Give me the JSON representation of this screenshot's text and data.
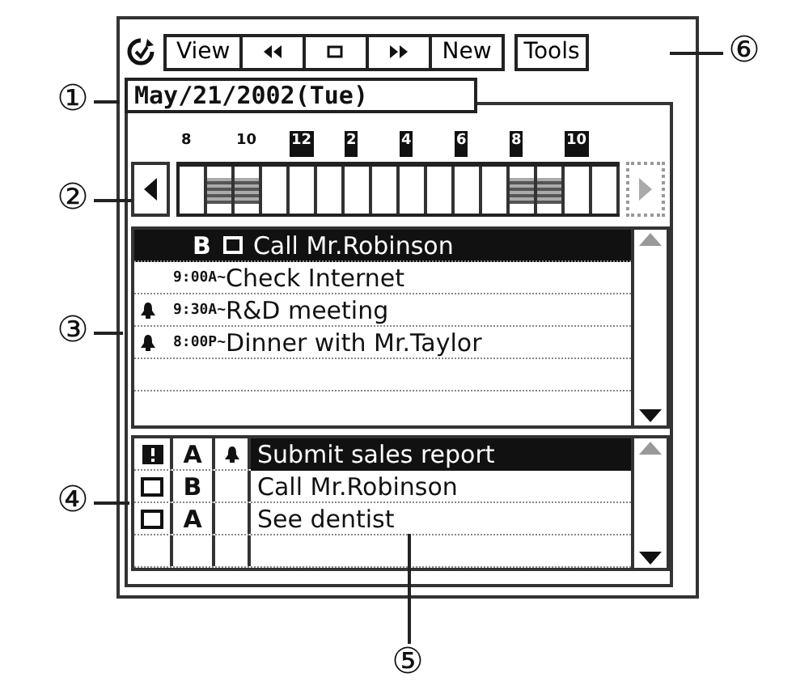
{
  "toolbar": {
    "buttons": [
      {
        "kind": "text",
        "label": "View"
      },
      {
        "kind": "rewind"
      },
      {
        "kind": "stop"
      },
      {
        "kind": "forward"
      },
      {
        "kind": "text",
        "label": "New"
      }
    ],
    "tools": "Tools"
  },
  "date": "May/21/2002(Tue)",
  "timeline": {
    "hours": [
      {
        "label": "8",
        "highlighted": false
      },
      {
        "label": "10",
        "highlighted": false
      },
      {
        "label": "12",
        "highlighted": true
      },
      {
        "label": "2",
        "highlighted": true
      },
      {
        "label": "4",
        "highlighted": true
      },
      {
        "label": "6",
        "highlighted": true
      },
      {
        "label": "8",
        "highlighted": true
      },
      {
        "label": "10",
        "highlighted": true
      }
    ],
    "slots": [
      {
        "busy": false
      },
      {
        "busy": true
      },
      {
        "busy": true
      },
      {
        "busy": false
      },
      {
        "busy": false
      },
      {
        "busy": false
      },
      {
        "busy": false
      },
      {
        "busy": false
      },
      {
        "busy": false
      },
      {
        "busy": false
      },
      {
        "busy": false
      },
      {
        "busy": false
      },
      {
        "busy": true
      },
      {
        "busy": true
      },
      {
        "busy": false
      },
      {
        "busy": false
      }
    ]
  },
  "schedule": [
    {
      "kind": "todo",
      "rank": "B",
      "checked": false,
      "text": "Call Mr.Robinson",
      "alarm": false,
      "selected": true
    },
    {
      "kind": "event",
      "time": "9:00A~",
      "text": "Check Internet",
      "alarm": false,
      "selected": false
    },
    {
      "kind": "event",
      "time": "9:30A~",
      "text": "R&D meeting",
      "alarm": true,
      "selected": false
    },
    {
      "kind": "event",
      "time": "8:00P~",
      "text": "Dinner with Mr.Taylor",
      "alarm": true,
      "selected": false
    }
  ],
  "todos": [
    {
      "kind": "important",
      "rank": "A",
      "alarm": true,
      "text": "Submit sales report",
      "selected": true
    },
    {
      "kind": "checkbox",
      "checked": false,
      "rank": "B",
      "alarm": false,
      "text": "Call Mr.Robinson",
      "selected": false
    },
    {
      "kind": "checkbox",
      "checked": false,
      "rank": "A",
      "alarm": false,
      "text": "See dentist",
      "selected": false
    }
  ],
  "callouts": [
    "①",
    "②",
    "③",
    "④",
    "⑤",
    "⑥"
  ]
}
